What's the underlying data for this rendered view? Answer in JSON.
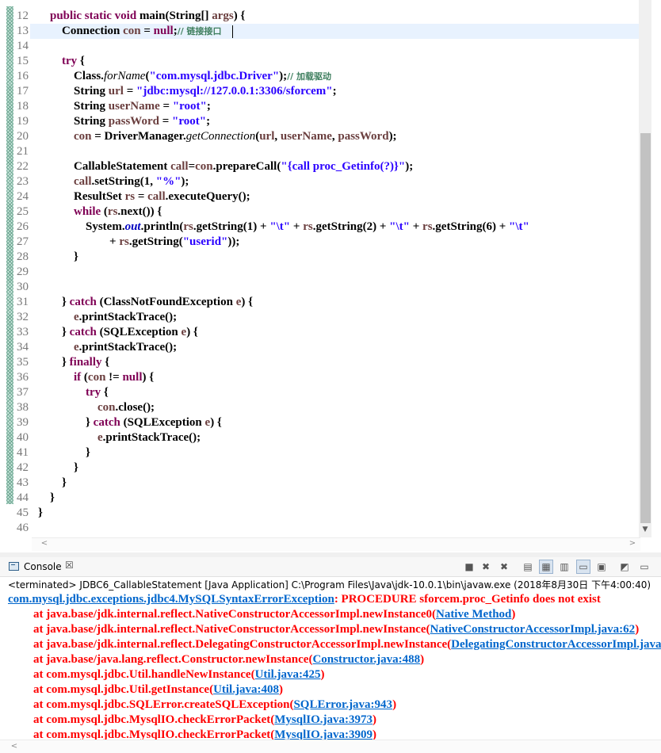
{
  "editor": {
    "lines": [
      {
        "n": "12",
        "html": "    <span class=\"kw\">public static void</span> main(String[] <span class=\"var\">args</span>) {"
      },
      {
        "n": "13",
        "html": "        Connection <span class=\"var\">con</span> = <span class=\"kw\">null</span>;<span class=\"cm\">// 链接接口</span>"
      },
      {
        "n": "14",
        "html": ""
      },
      {
        "n": "15",
        "html": "        <span class=\"kw\">try</span> {"
      },
      {
        "n": "16",
        "html": "            Class.<span class=\"it\">forName</span>(<span class=\"str\">\"com.mysql.jdbc.Driver\"</span>);<span class=\"cm\">// 加载驱动</span>"
      },
      {
        "n": "17",
        "html": "            String <span class=\"var\">url</span> = <span class=\"str\">\"jdbc:mysql://127.0.0.1:3306/sforcem\"</span>;"
      },
      {
        "n": "18",
        "html": "            String <span class=\"var\">userName</span> = <span class=\"str\">\"root\"</span>;"
      },
      {
        "n": "19",
        "html": "            String <span class=\"var\">passWord</span> = <span class=\"str\">\"root\"</span>;"
      },
      {
        "n": "20",
        "html": "            <span class=\"var\">con</span> = DriverManager.<span class=\"it\">getConnection</span>(<span class=\"var\">url</span>, <span class=\"var\">userName</span>, <span class=\"var\">passWord</span>);"
      },
      {
        "n": "21",
        "html": ""
      },
      {
        "n": "22",
        "html": "            CallableStatement <span class=\"var\">call</span>=<span class=\"var\">con</span>.prepareCall(<span class=\"str\">\"{call proc_Getinfo(?)}\"</span>);"
      },
      {
        "n": "23",
        "html": "            <span class=\"var\">call</span>.setString(1, <span class=\"str\">\"%\"</span>);"
      },
      {
        "n": "24",
        "html": "            ResultSet <span class=\"var\">rs</span> = <span class=\"var\">call</span>.executeQuery();"
      },
      {
        "n": "25",
        "html": "            <span class=\"kw\">while</span> (<span class=\"var\">rs</span>.next()) {"
      },
      {
        "n": "26",
        "html": "                System.<span class=\"fld\">out</span>.println(<span class=\"var\">rs</span>.getString(1) + <span class=\"str\">\"\\t\"</span> + <span class=\"var\">rs</span>.getString(2) + <span class=\"str\">\"\\t\"</span> + <span class=\"var\">rs</span>.getString(6) + <span class=\"str\">\"\\t\"</span>"
      },
      {
        "n": "27",
        "html": "                        + <span class=\"var\">rs</span>.getString(<span class=\"str\">\"userid\"</span>));"
      },
      {
        "n": "28",
        "html": "            }"
      },
      {
        "n": "29",
        "html": ""
      },
      {
        "n": "30",
        "html": ""
      },
      {
        "n": "31",
        "html": "        } <span class=\"kw\">catch</span> (ClassNotFoundException <span class=\"var\">e</span>) {"
      },
      {
        "n": "32",
        "html": "            <span class=\"var\">e</span>.printStackTrace();"
      },
      {
        "n": "33",
        "html": "        } <span class=\"kw\">catch</span> (SQLException <span class=\"var\">e</span>) {"
      },
      {
        "n": "34",
        "html": "            <span class=\"var\">e</span>.printStackTrace();"
      },
      {
        "n": "35",
        "html": "        } <span class=\"kw\">finally</span> {"
      },
      {
        "n": "36",
        "html": "            <span class=\"kw\">if</span> (<span class=\"var\">con</span> != <span class=\"kw\">null</span>) {"
      },
      {
        "n": "37",
        "html": "                <span class=\"kw\">try</span> {"
      },
      {
        "n": "38",
        "html": "                    <span class=\"var\">con</span>.close();"
      },
      {
        "n": "39",
        "html": "                } <span class=\"kw\">catch</span> (SQLException <span class=\"var\">e</span>) {"
      },
      {
        "n": "40",
        "html": "                    <span class=\"var\">e</span>.printStackTrace();"
      },
      {
        "n": "41",
        "html": "                }"
      },
      {
        "n": "42",
        "html": "            }"
      },
      {
        "n": "43",
        "html": "        }"
      },
      {
        "n": "44",
        "html": "    }"
      },
      {
        "n": "45",
        "html": "}"
      },
      {
        "n": "46",
        "html": ""
      }
    ],
    "scroll_left_arrow": "<",
    "scroll_right_arrow": ">",
    "scroll_down_arrow": "▼"
  },
  "console": {
    "tab_title": "Console",
    "tab_close": "☒",
    "status": "<terminated> JDBC6_CallableStatement [Java Application] C:\\Program Files\\Java\\jdk-10.0.1\\bin\\javaw.exe (2018年8月30日 下午4:00:40)",
    "toolbar": [
      {
        "name": "terminate-icon",
        "glyph": "■"
      },
      {
        "name": "remove-launch-icon",
        "glyph": "✖"
      },
      {
        "name": "remove-all-launches-icon",
        "glyph": "✖"
      },
      {
        "name": "clear-console-icon",
        "glyph": "▤"
      },
      {
        "name": "scroll-lock-icon",
        "glyph": "▦"
      },
      {
        "name": "word-wrap-icon",
        "glyph": "▥"
      },
      {
        "name": "show-on-stdout-icon",
        "glyph": "▭"
      },
      {
        "name": "show-on-stderr-icon",
        "glyph": "▣"
      },
      {
        "name": "pin-console-icon",
        "glyph": "◩"
      },
      {
        "name": "display-console-icon",
        "glyph": "▭"
      }
    ],
    "output": [
      {
        "indent": 0,
        "html": "<span class=\"lnk\">com.mysql.jdbc.exceptions.jdbc4.MySQLSyntaxErrorException</span>: PROCEDURE sforcem.proc_Getinfo does not exist"
      },
      {
        "indent": 1,
        "html": "at java.base/jdk.internal.reflect.NativeConstructorAccessorImpl.newInstance0(<span class=\"lnk\">Native Method</span>)"
      },
      {
        "indent": 1,
        "html": "at java.base/jdk.internal.reflect.NativeConstructorAccessorImpl.newInstance(<span class=\"lnk\">NativeConstructorAccessorImpl.java:62</span>)"
      },
      {
        "indent": 1,
        "html": "at java.base/jdk.internal.reflect.DelegatingConstructorAccessorImpl.newInstance(<span class=\"lnk\">DelegatingConstructorAccessorImpl.java:45</span>)"
      },
      {
        "indent": 1,
        "html": "at java.base/java.lang.reflect.Constructor.newInstance(<span class=\"lnk\">Constructor.java:488</span>)"
      },
      {
        "indent": 1,
        "html": "at com.mysql.jdbc.Util.handleNewInstance(<span class=\"lnk\">Util.java:425</span>)"
      },
      {
        "indent": 1,
        "html": "at com.mysql.jdbc.Util.getInstance(<span class=\"lnk\">Util.java:408</span>)"
      },
      {
        "indent": 1,
        "html": "at com.mysql.jdbc.SQLError.createSQLException(<span class=\"lnk\">SQLError.java:943</span>)"
      },
      {
        "indent": 1,
        "html": "at com.mysql.jdbc.MysqlIO.checkErrorPacket(<span class=\"lnk\">MysqlIO.java:3973</span>)"
      },
      {
        "indent": 1,
        "html": "at com.mysql.jdbc.MysqlIO.checkErrorPacket(<span class=\"lnk\">MysqlIO.java:3909</span>)"
      }
    ],
    "scroll_left_arrow": "<"
  }
}
